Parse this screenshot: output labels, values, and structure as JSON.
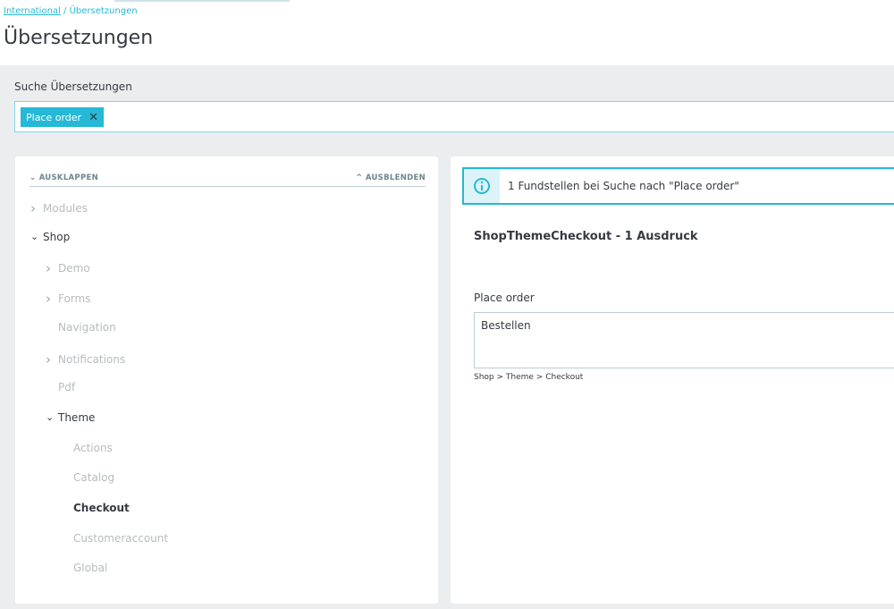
{
  "breadcrumb": {
    "items": [
      "International",
      "Übersetzungen"
    ],
    "separator": "/"
  },
  "page": {
    "title": "Übersetzungen"
  },
  "search": {
    "label": "Suche Übersetzungen",
    "tags": [
      "Place order"
    ]
  },
  "tree": {
    "expand_label": "AUSKLAPPEN",
    "collapse_label": "AUSBLENDEN",
    "nodes": [
      {
        "label": "Modules",
        "level": 0,
        "state": "collapsed"
      },
      {
        "label": "Shop",
        "level": 0,
        "state": "expanded"
      },
      {
        "label": "Demo",
        "level": 1,
        "state": "collapsed"
      },
      {
        "label": "Forms",
        "level": 1,
        "state": "collapsed"
      },
      {
        "label": "Navigation",
        "level": 1,
        "state": "leaf"
      },
      {
        "label": "Notifications",
        "level": 1,
        "state": "collapsed"
      },
      {
        "label": "Pdf",
        "level": 1,
        "state": "leaf"
      },
      {
        "label": "Theme",
        "level": 1,
        "state": "expanded"
      },
      {
        "label": "Actions",
        "level": 2,
        "state": "leaf"
      },
      {
        "label": "Catalog",
        "level": 2,
        "state": "leaf"
      },
      {
        "label": "Checkout",
        "level": 2,
        "state": "selected"
      },
      {
        "label": "Customeraccount",
        "level": 2,
        "state": "leaf"
      },
      {
        "label": "Global",
        "level": 2,
        "state": "leaf"
      }
    ]
  },
  "results": {
    "info": "1 Fundstellen bei Suche nach \"Place order\"",
    "domain_title": "ShopThemeCheckout - 1 Ausdruck",
    "entries": [
      {
        "source": "Place order",
        "translation": "Bestellen",
        "path": "Shop > Theme > Checkout"
      }
    ]
  },
  "colors": {
    "accent": "#25b9d7",
    "background": "#ebedef"
  }
}
